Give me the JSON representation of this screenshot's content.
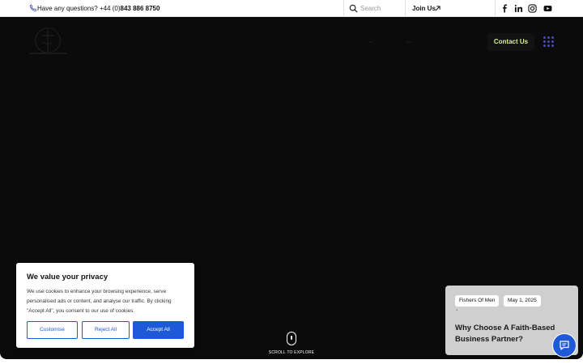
{
  "topbar": {
    "question_text": "Have any questions? +44 (0)",
    "phone_number": "843 886 8750",
    "search_placeholder": "Search",
    "join_label": "Join Us"
  },
  "hero": {
    "contact_label": "Contact Us",
    "scroll_label": "SCROLL TO EXPLORE"
  },
  "cookie": {
    "title": "We value your privacy",
    "text": "We use cookies to enhance your browsing experience, serve personalised ads or content, and analyse our traffic. By clicking \"Accept All\", you consent to our use of cookies.",
    "customise_label": "Customise",
    "reject_label": "Reject All",
    "accept_label": "Accept All"
  },
  "post_card": {
    "category": "Fishers Of Men",
    "date": "May 1, 2025",
    "tick": "`",
    "title": "Why Choose A Faith-Based Business Partner?"
  },
  "icons": {
    "phone": "phone-icon",
    "search": "search-icon",
    "join_arrow": "arrow-up-right-icon",
    "facebook": "facebook-icon",
    "linkedin": "linkedin-icon",
    "instagram": "instagram-icon",
    "youtube": "youtube-icon",
    "menu": "grid-menu-icon",
    "chat": "chat-icon"
  },
  "colors": {
    "hero_bg": "#0b0b0b",
    "contact_text": "#d6f28b",
    "accent_blue": "#1e5ad8",
    "card_bg": "#cfcfcf"
  }
}
